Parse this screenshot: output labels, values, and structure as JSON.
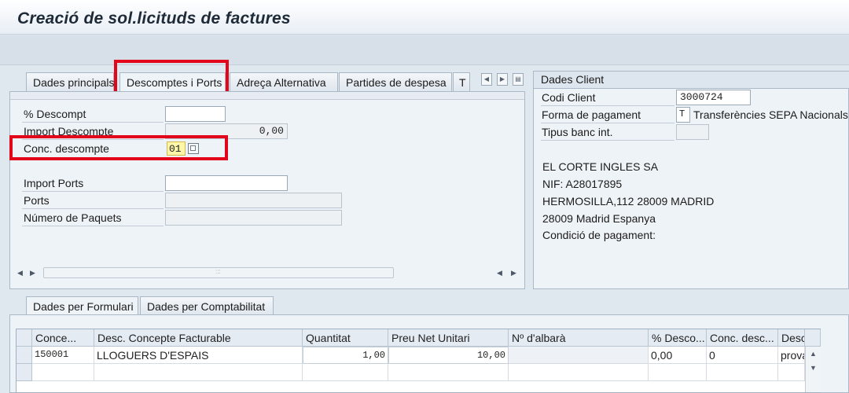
{
  "title": "Creació de sol.licituds de factures",
  "top_tabs": [
    {
      "label": "Dades principals"
    },
    {
      "label": "Descomptes i Ports"
    },
    {
      "label": "Adreça Alternativa"
    },
    {
      "label": "Partides de despesa"
    },
    {
      "label": "T"
    }
  ],
  "discount": {
    "pct_label": "% Descompt",
    "pct_value": "",
    "import_label": "Import Descompte",
    "import_value": "0,00",
    "concept_label": "Conc. descompte",
    "concept_value": "01"
  },
  "ports": {
    "import_label": "Import Ports",
    "ports_label": "Ports",
    "paquets_label": "Número de Paquets"
  },
  "client": {
    "header": "Dades Client",
    "code_label": "Codi Client",
    "code_value": "3000724",
    "payment_label": "Forma de pagament",
    "payment_code": "T",
    "payment_value": "Transferències SEPA Nacionals",
    "bank_label": "Tipus banc int.",
    "name": "EL CORTE INGLES SA",
    "nif": "NIF: A28017895",
    "address1": "HERMOSILLA,112 28009 MADRID",
    "address2": "28009 Madrid Espanya",
    "conditions": "Condició de pagament:"
  },
  "bottom_tabs": [
    {
      "label": "Dades per Formulari"
    },
    {
      "label": "Dades per Comptabilitat"
    }
  ],
  "grid": {
    "columns": [
      "Conce...",
      "Desc. Concepte Facturable",
      "Quantitat",
      "Preu Net Unitari",
      "Nº d'albarà",
      "% Desco...",
      "Conc. desc...",
      "Descripc"
    ],
    "rows": [
      [
        "150001",
        "LLOGUERS D'ESPAIS",
        "1,00",
        "10,00",
        "",
        "0,00",
        "0",
        "prova"
      ]
    ]
  }
}
